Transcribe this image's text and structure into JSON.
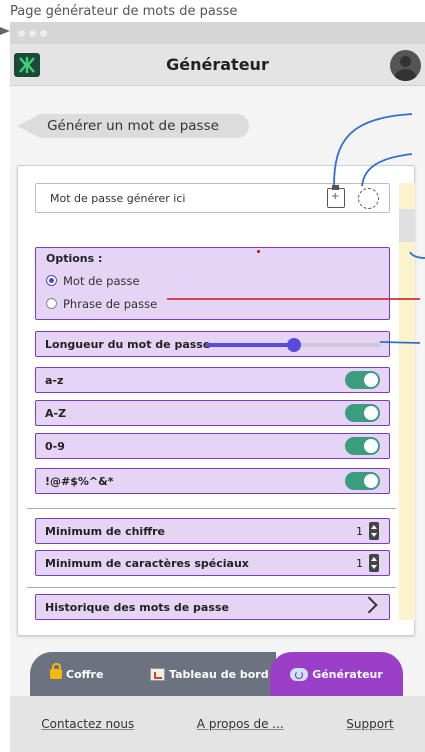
{
  "page_label": "Page générateur de mots de passe",
  "header": {
    "title": "Générateur"
  },
  "nav": {
    "back_label": "Générer un mot de passe"
  },
  "password_field": {
    "value": "Mot de passe générer ici"
  },
  "options": {
    "title": "Options :",
    "items": [
      {
        "label": "Mot de passe",
        "selected": true
      },
      {
        "label": "Phrase de passe",
        "selected": false
      }
    ]
  },
  "length": {
    "label": "Longueur du mot de passe",
    "fill_fraction": 0.5
  },
  "charsets": [
    {
      "label": "a-z",
      "enabled": true
    },
    {
      "label": "A-Z",
      "enabled": true
    },
    {
      "label": "0-9",
      "enabled": true
    },
    {
      "label": "!@#$%^&*",
      "enabled": true
    }
  ],
  "minimums": [
    {
      "label": "Minimum de chiffre",
      "value": "1"
    },
    {
      "label": "Minimum de caractères spéciaux",
      "value": "1"
    }
  ],
  "history": {
    "label": "Historique des mots de passe"
  },
  "tabs": [
    {
      "label": "Coffre",
      "icon": "lock-icon"
    },
    {
      "label": "Tableau de bord",
      "icon": "board-icon"
    },
    {
      "label": "Générateur",
      "icon": "cloud-refresh-icon",
      "active": true
    }
  ],
  "footer": {
    "links": [
      "Contactez nous",
      "A propos de ...",
      "Support"
    ]
  },
  "colors": {
    "accent_purple": "#9b3ec8",
    "option_bg": "#e6d4f5",
    "option_border": "#7a3cc8",
    "toggle_on": "#3c9c80",
    "slider": "#5a4ae0",
    "annotation_blue": "#2f6fd0",
    "annotation_red": "#d03040"
  }
}
